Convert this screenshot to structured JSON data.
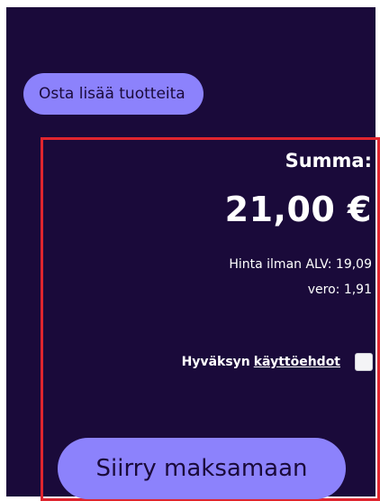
{
  "actions": {
    "continue_shopping_label": "Osta lisää tuotteita",
    "checkout_label": "Siirry maksamaan"
  },
  "summary": {
    "title": "Summa:",
    "total": "21,00 €",
    "price_without_vat": "Hinta ilman ALV: 19,09",
    "tax": "vero: 1,91"
  },
  "terms": {
    "prefix": "Hyväksyn",
    "link_label": "käyttöehdot",
    "accepted": false
  },
  "colors": {
    "background": "#1a0a3a",
    "accent": "#8c82fc",
    "highlight_border": "#e0252e"
  }
}
